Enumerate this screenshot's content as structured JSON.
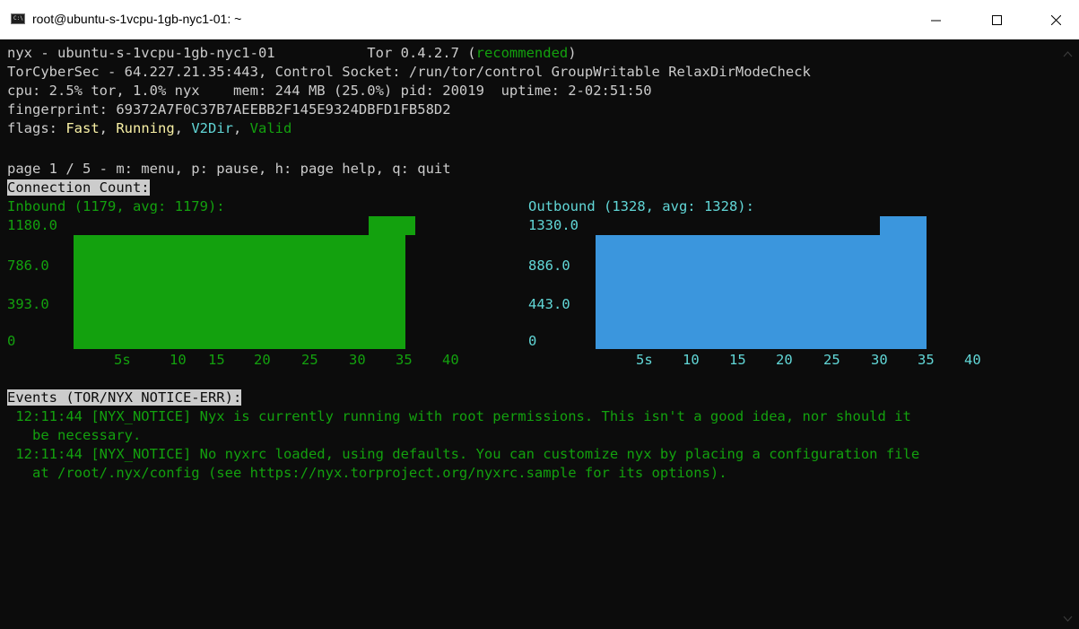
{
  "window": {
    "title": "root@ubuntu-s-1vcpu-1gb-nyc1-01: ~",
    "icon_text": "C:\\"
  },
  "header": {
    "line1_prefix": "nyx - ubuntu-s-1vcpu-1gb-nyc1-01",
    "line1_tor": "Tor 0.4.2.7 (",
    "line1_status": "recommended",
    "line1_close": ")",
    "line2": "TorCyberSec - 64.227.21.35:443, Control Socket: /run/tor/control GroupWritable RelaxDirModeCheck",
    "line3": "cpu: 2.5% tor, 1.0% nyx    mem: 244 MB (25.0%) pid: 20019  uptime: 2-02:51:50",
    "line4": "fingerprint: 69372A7F0C37B7AEEBB2F145E9324DBFD1FB58D2",
    "flags_label": "flags: ",
    "flags": [
      "Fast",
      "Running",
      "V2Dir",
      "Valid"
    ],
    "page_line": "page 1 / 5 - m: menu, p: pause, h: page help, q: quit"
  },
  "graph": {
    "section_title": "Connection Count:",
    "inbound": {
      "title": "Inbound (1179, avg: 1179):",
      "y_labels": [
        "1180.0",
        "786.0",
        "393.0",
        "0"
      ],
      "x_labels": [
        "5s",
        "10",
        "15",
        "20",
        "25",
        "30",
        "35",
        "40"
      ],
      "max": 1180,
      "color": "#13a10e"
    },
    "outbound": {
      "title": "Outbound (1328, avg: 1328):",
      "y_labels": [
        "1330.0",
        "886.0",
        "443.0",
        "0"
      ],
      "x_labels": [
        "5s",
        "10",
        "15",
        "20",
        "25",
        "30",
        "35",
        "40"
      ],
      "max": 1330,
      "color": "#3b96dd"
    }
  },
  "events": {
    "section_title": "Events (TOR/NYX NOTICE-ERR):",
    "entries": [
      {
        "line1": " 12:11:44 [NYX_NOTICE] Nyx is currently running with root permissions. This isn't a good idea, nor should it",
        "line2": "   be necessary."
      },
      {
        "line1": " 12:11:44 [NYX_NOTICE] No nyxrc loaded, using defaults. You can customize nyx by placing a configuration file",
        "line2": "   at /root/.nyx/config (see https://nyx.torproject.org/nyxrc.sample for its options)."
      }
    ]
  }
}
